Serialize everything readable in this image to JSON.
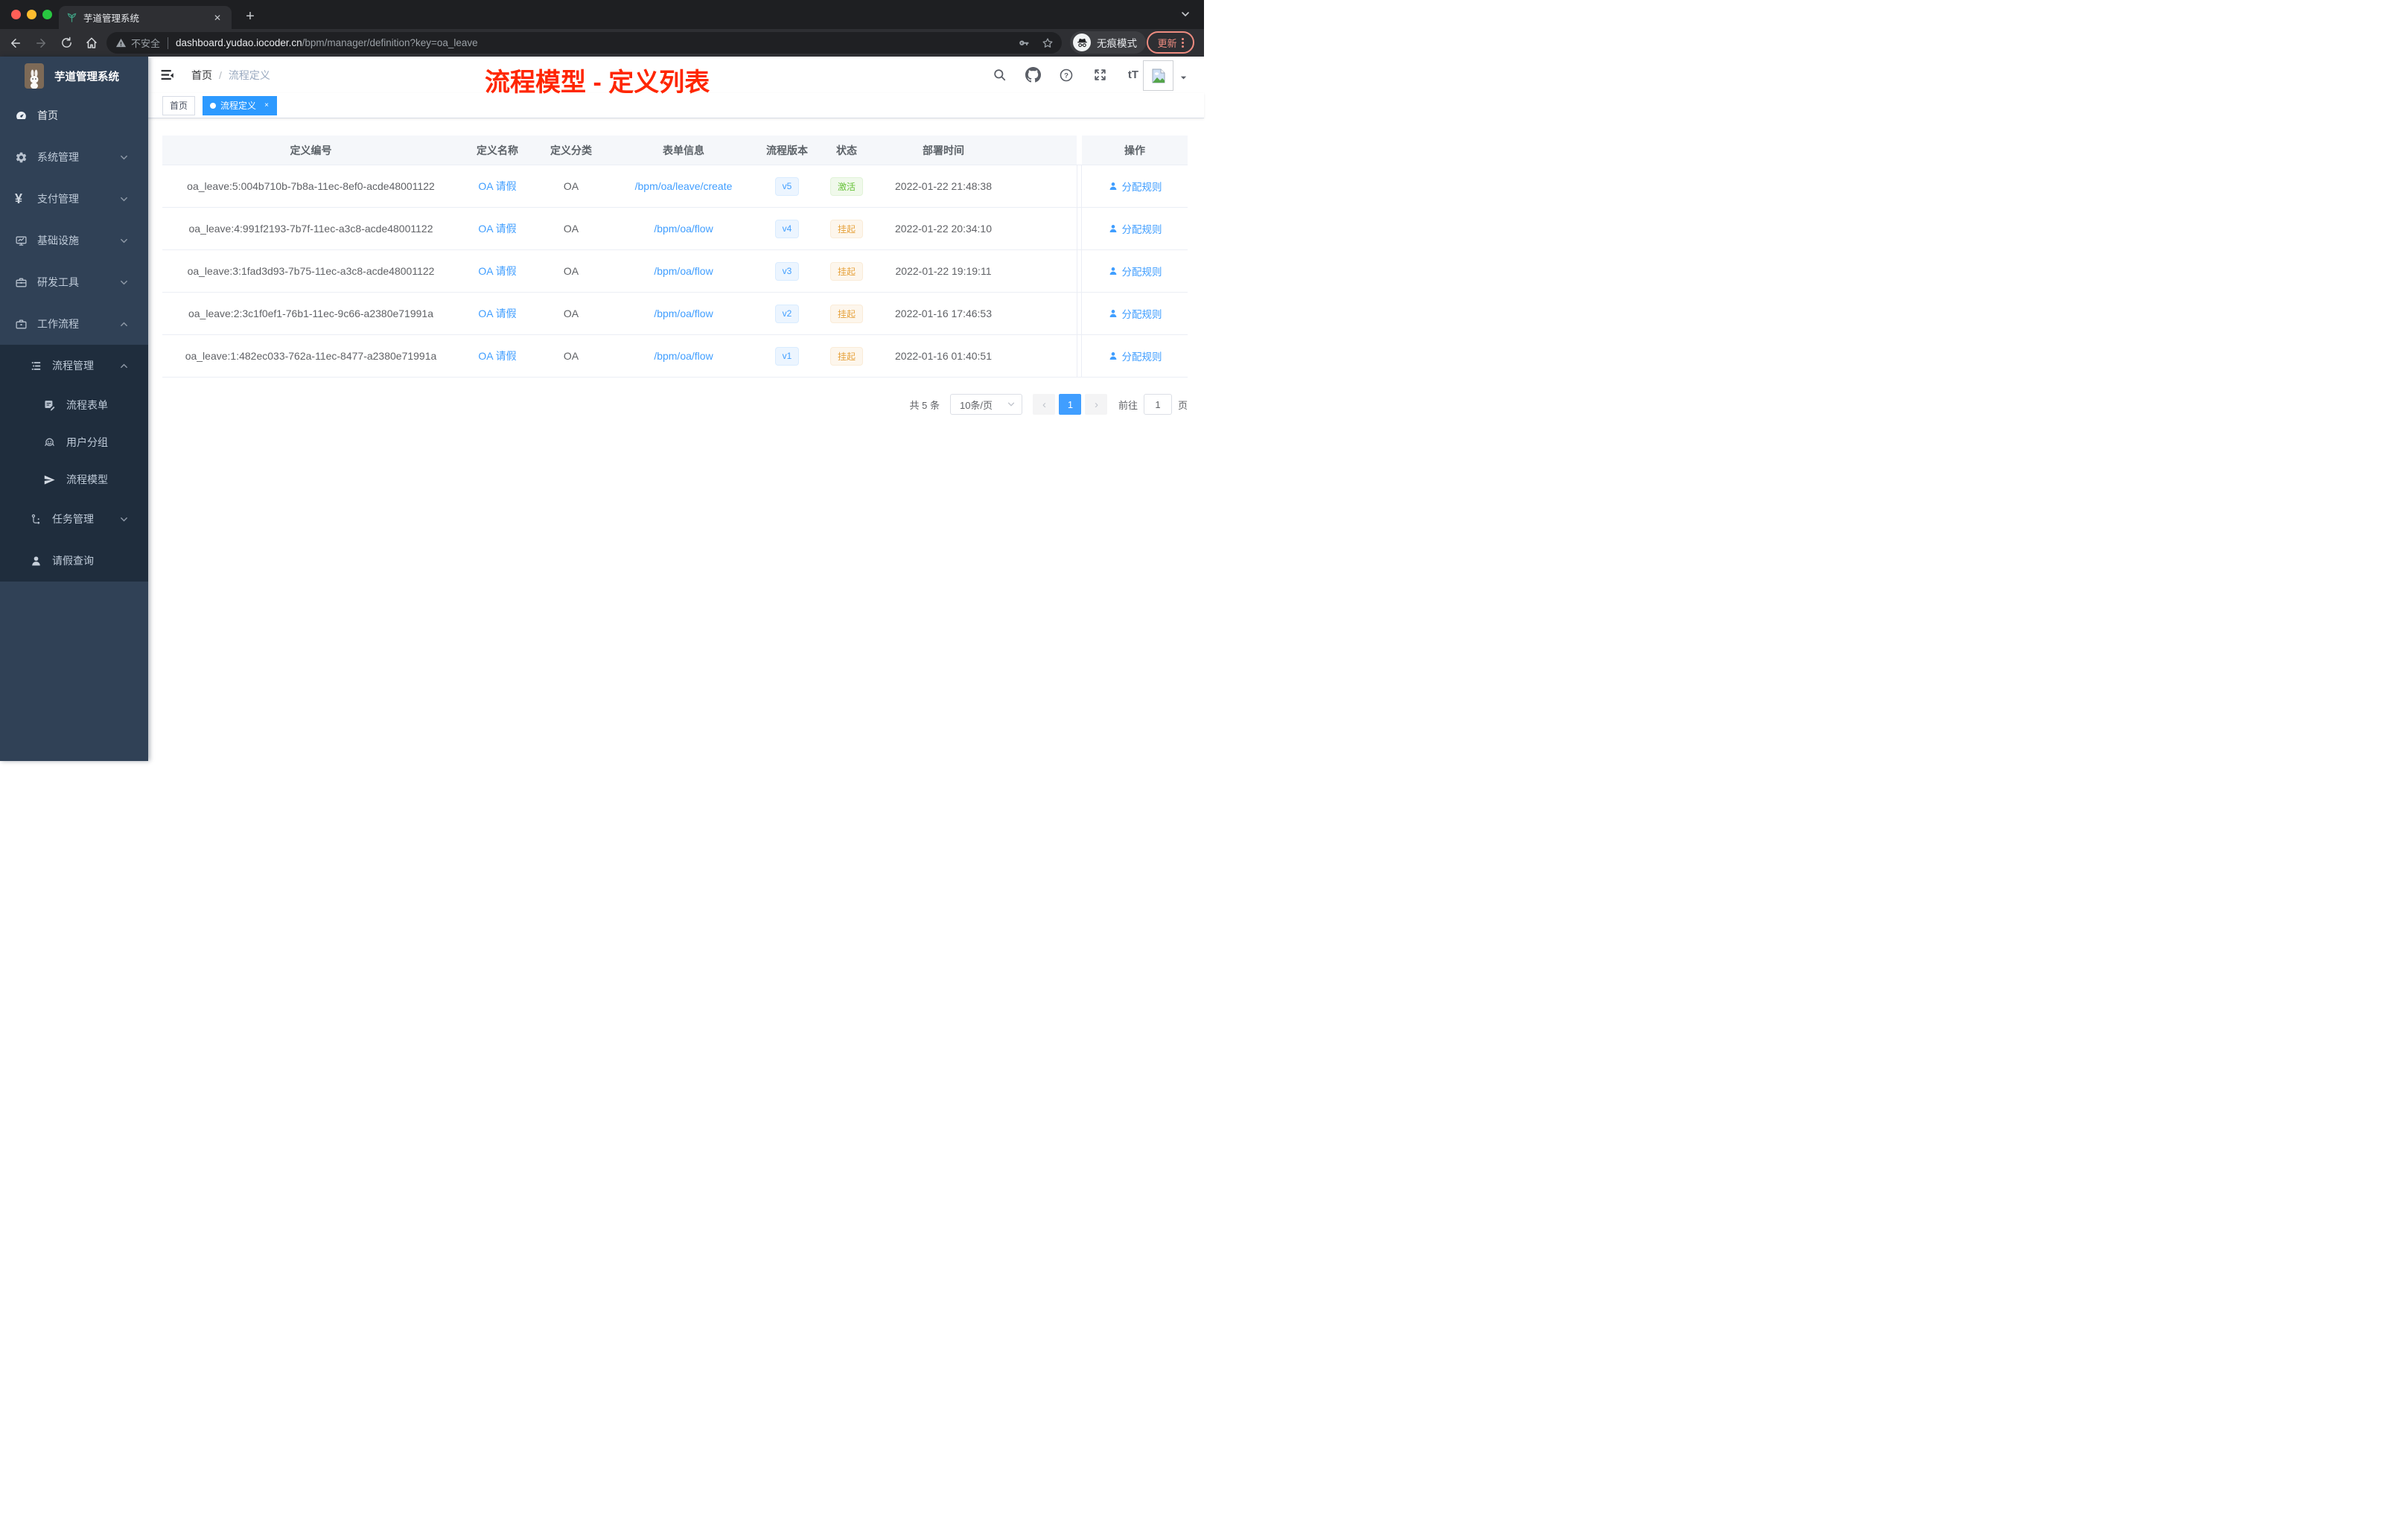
{
  "colors": {
    "accent_blue": "#409eff",
    "annotation_red": "#ff2600",
    "sidebar_bg": "#304156",
    "submenu_bg": "#1f2d3d",
    "status_active_green": "#67c23a",
    "status_suspend_orange": "#e6a23c",
    "chrome_update_red": "#ee8c80",
    "table_header_bg": "#f5f7fa"
  },
  "browser": {
    "tab_title": "芋道管理系统",
    "close_glyph": "✕",
    "new_tab_glyph": "+",
    "url_warning": "不安全",
    "url_domain": "dashboard.yudao.iocoder.cn",
    "url_path": "/bpm/manager/definition?key=oa_leave",
    "incognito_label": "无痕模式",
    "update_label": "更新"
  },
  "icons": {
    "favicon": "green-plant-icon",
    "toolbar": [
      "back-icon",
      "forward-icon",
      "reload-icon",
      "home-icon",
      "key-icon",
      "star-icon",
      "incognito-icon"
    ],
    "app_header": [
      "search-icon",
      "github-icon",
      "question-icon",
      "fullscreen-icon",
      "font-size-icon",
      "avatar-broken-image-icon"
    ]
  },
  "sidebar": {
    "logo_title": "芋道管理系统",
    "items": [
      {
        "label": "首页"
      },
      {
        "label": "系统管理"
      },
      {
        "label": "支付管理"
      },
      {
        "label": "基础设施"
      },
      {
        "label": "研发工具"
      },
      {
        "label": "工作流程"
      },
      {
        "label": "流程管理"
      },
      {
        "label": "流程表单"
      },
      {
        "label": "用户分组"
      },
      {
        "label": "流程模型"
      },
      {
        "label": "任务管理"
      },
      {
        "label": "请假查询"
      }
    ]
  },
  "header": {
    "breadcrumb_home": "首页",
    "breadcrumb_sep": "/",
    "breadcrumb_current": "流程定义",
    "font_icon_text": "tT",
    "annotation": "流程模型 - 定义列表"
  },
  "tags": {
    "items": [
      {
        "label": "首页"
      },
      {
        "label": "流程定义"
      }
    ]
  },
  "table": {
    "columns": [
      "定义编号",
      "定义名称",
      "定义分类",
      "表单信息",
      "流程版本",
      "状态",
      "部署时间",
      "操作"
    ],
    "rows": [
      {
        "id": "oa_leave:5:004b710b-7b8a-11ec-8ef0-acde48001122",
        "name": "OA 请假",
        "category": "OA",
        "form": "/bpm/oa/leave/create",
        "version": "v5",
        "status": "激活",
        "deploy_time": "2022-01-22 21:48:38",
        "action": "分配规则"
      },
      {
        "id": "oa_leave:4:991f2193-7b7f-11ec-a3c8-acde48001122",
        "name": "OA 请假",
        "category": "OA",
        "form": "/bpm/oa/flow",
        "version": "v4",
        "status": "挂起",
        "deploy_time": "2022-01-22 20:34:10",
        "action": "分配规则"
      },
      {
        "id": "oa_leave:3:1fad3d93-7b75-11ec-a3c8-acde48001122",
        "name": "OA 请假",
        "category": "OA",
        "form": "/bpm/oa/flow",
        "version": "v3",
        "status": "挂起",
        "deploy_time": "2022-01-22 19:19:11",
        "action": "分配规则"
      },
      {
        "id": "oa_leave:2:3c1f0ef1-76b1-11ec-9c66-a2380e71991a",
        "name": "OA 请假",
        "category": "OA",
        "form": "/bpm/oa/flow",
        "version": "v2",
        "status": "挂起",
        "deploy_time": "2022-01-16 17:46:53",
        "action": "分配规则"
      },
      {
        "id": "oa_leave:1:482ec033-762a-11ec-8477-a2380e71991a",
        "name": "OA 请假",
        "category": "OA",
        "form": "/bpm/oa/flow",
        "version": "v1",
        "status": "挂起",
        "deploy_time": "2022-01-16 01:40:51",
        "action": "分配规则"
      }
    ]
  },
  "pagination": {
    "total": "共 5 条",
    "page_size": "10条/页",
    "prev_glyph": "‹",
    "next_glyph": "›",
    "page": "1",
    "goto_label": "前往",
    "page_unit": "页"
  }
}
